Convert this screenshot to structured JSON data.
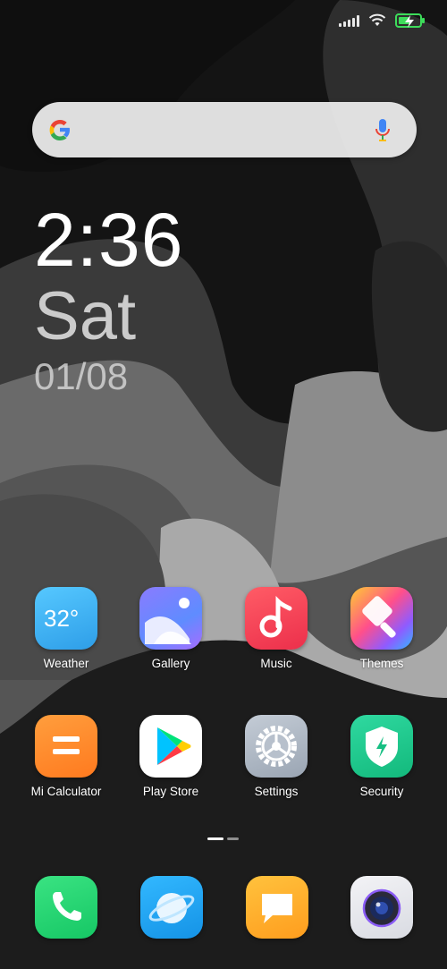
{
  "status_bar": {
    "icons": [
      "signal-icon",
      "wifi-icon",
      "battery-charging-icon"
    ]
  },
  "search": {
    "placeholder": "",
    "icons": [
      "google-logo",
      "microphone-icon"
    ]
  },
  "clock": {
    "time": "2:36",
    "day": "Sat",
    "date": "01/08"
  },
  "weather_widget": {
    "temperature": "32°"
  },
  "apps": [
    {
      "label": "Weather"
    },
    {
      "label": "Gallery"
    },
    {
      "label": "Music"
    },
    {
      "label": "Themes"
    },
    {
      "label": "Mi Calculator"
    },
    {
      "label": "Play Store"
    },
    {
      "label": "Settings"
    },
    {
      "label": "Security"
    }
  ],
  "dock": [
    {
      "icon": "phone-icon"
    },
    {
      "icon": "browser-icon"
    },
    {
      "icon": "messages-icon"
    },
    {
      "icon": "camera-icon"
    }
  ],
  "page_indicator": {
    "pages": 2,
    "current": 1
  },
  "colors": {
    "battery": "#3ddc5a",
    "weather": "#3fb6f5",
    "music": "#f2434f",
    "calculator": "#ff8a2a",
    "security": "#1fc98c",
    "phone": "#1fd26e",
    "browser": "#1aa4f0",
    "messages": "#ffb02a"
  }
}
